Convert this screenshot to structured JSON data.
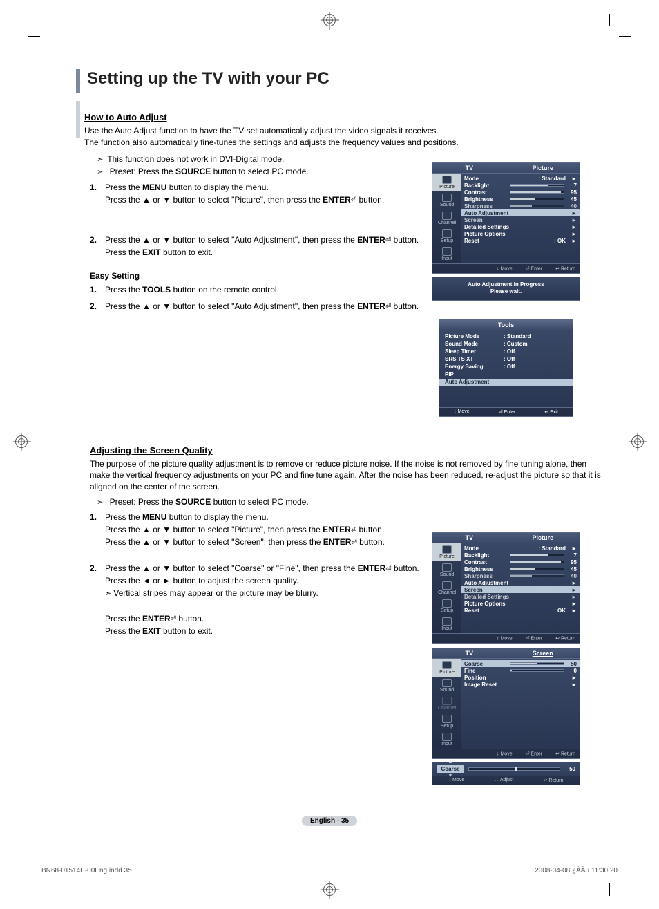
{
  "title": "Setting up the TV with your PC",
  "section1_hdr": "How to Auto Adjust",
  "section1_p1": "Use the Auto Adjust function to have the TV set automatically adjust the video signals it receives.",
  "section1_p2": "The function also automatically fine-tunes the settings and adjusts the frequency values and positions.",
  "note1": "This function does not work in DVI-Digital mode.",
  "note2_pre": "Preset: Press the ",
  "note2_bold": "SOURCE",
  "note2_post": " button to select PC mode.",
  "step1a_pre": "Press the ",
  "step1a_b": "MENU",
  "step1a_post": " button to display the menu.",
  "step1b": "Press the ▲ or ▼ button to select \"Picture\", then press the ",
  "step1b_b": "ENTER",
  "step1b_post": " button.",
  "step2a": "Press the ▲ or ▼ button to select \"Auto Adjustment\", then press the ",
  "step2a_b": "ENTER",
  "step2a_post": " button.",
  "step2b_pre": "Press the ",
  "step2b_b": "EXIT",
  "step2b_post": " button to exit.",
  "easy_hdr": "Easy Setting",
  "easy1_pre": "Press the ",
  "easy1_b": "TOOLS",
  "easy1_post": " button on the remote control.",
  "easy2": "Press the ▲ or ▼ button to select \"Auto Adjustment\", then press the ",
  "easy2_b": "ENTER",
  "easy2_post": " button.",
  "section2_hdr": "Adjusting the Screen Quality",
  "section2_p": "The purpose of the picture quality adjustment is to remove or reduce picture noise. If the noise is not removed by fine tuning alone, then make the vertical frequency adjustments on your PC and fine tune again. After the noise has been reduced, re-adjust the picture so that it is aligned on the center of the screen.",
  "note3_pre": "Preset: Press the ",
  "note3_b": "SOURCE",
  "note3_post": " button to select PC mode.",
  "b_step1a_pre": "Press the ",
  "b_step1a_b": "MENU",
  "b_step1a_post": " button to display the menu.",
  "b_step1b": "Press the ▲ or ▼ button to select \"Picture\", then press the ",
  "b_step1b_b": "ENTER",
  "b_step1b_post": " button.",
  "b_step1c": "Press the ▲ or ▼ button to select \"Screen\", then press the ",
  "b_step1c_b": "ENTER",
  "b_step1c_post": " button.",
  "b_step2a": "Press the ▲ or ▼ button to select \"Coarse\" or \"Fine\", then press the ",
  "b_step2a_b": "ENTER",
  "b_step2a_post": " button.",
  "b_step2b": "Press the ◄ or ► button to adjust the screen quality.",
  "b_step2c": "Vertical stripes may appear or the picture may be blurry.",
  "b_step2d_pre": "Press the ",
  "b_step2d_b": "ENTER",
  "b_step2d_post": " button.",
  "b_step2e_pre": "Press the ",
  "b_step2e_b": "EXIT",
  "b_step2e_post": " button to exit.",
  "osd": {
    "tab_tv": "TV",
    "tab_picture": "Picture",
    "tab_screen": "Screen",
    "side_picture": "Picture",
    "side_sound": "Sound",
    "side_channel": "Channel",
    "side_setup": "Setup",
    "side_input": "Input",
    "mode": "Mode",
    "mode_v": ": Standard",
    "backlight": "Backlight",
    "backlight_v": "7",
    "contrast": "Contrast",
    "contrast_v": "95",
    "brightness": "Brightness",
    "brightness_v": "45",
    "sharpness": "Sharpness",
    "sharpness_v": "40",
    "auto_adj": "Auto Adjustment",
    "screen": "Screen",
    "det_set": "Detailed Settings",
    "pic_opt": "Picture Options",
    "reset": "Reset",
    "reset_v": ": OK",
    "coarse": "Coarse",
    "coarse_v": "50",
    "fine": "Fine",
    "fine_v": "0",
    "position": "Position",
    "image_reset": "Image Reset",
    "foot_move": "Move",
    "foot_enter": "Enter",
    "foot_return": "Return",
    "foot_adjust": "Adjust",
    "foot_exit": "Exit"
  },
  "msg_l1": "Auto Adjustment in Progress",
  "msg_l2": "Please wait.",
  "tools": {
    "hdr": "Tools",
    "pm": "Picture Mode",
    "pm_v": ": Standard",
    "sm": "Sound Mode",
    "sm_v": ": Custom",
    "st": "Sleep Timer",
    "st_v": ": Off",
    "srs": "SRS TS XT",
    "srs_v": ": Off",
    "es": "Energy Saving",
    "es_v": ": Off",
    "pip": "PIP",
    "aa": "Auto Adjustment"
  },
  "page_foot": "English - 35",
  "indd_file": "BN68-01514E-00Eng.indd   35",
  "indd_time": "2008-04-08   ¿ÀÀü 11:30:20",
  "foot_sym_updown": "↕",
  "foot_sym_enter": "⏎",
  "foot_sym_return": "↩",
  "foot_sym_lr": "↔"
}
